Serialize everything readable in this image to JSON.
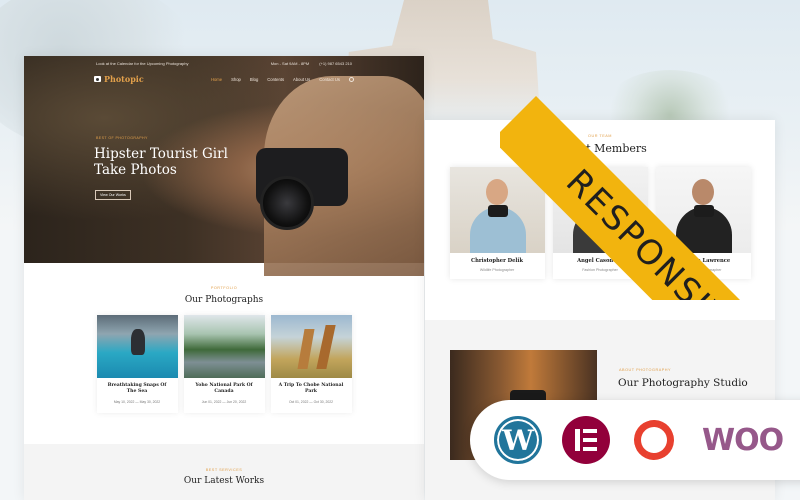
{
  "ribbon": {
    "label": "RESPONSIVE"
  },
  "topbar": {
    "left": "Look at the Calendar for the Upcoming Photography",
    "hours": "Mon - Sat 9AM - 8PM",
    "phone": "(+1) 987 6543 210"
  },
  "brand": {
    "name": "Photopic"
  },
  "nav": {
    "items": [
      "Home",
      "Shop",
      "Blog",
      "Contents",
      "About Us",
      "Contact Us"
    ],
    "active": "Home"
  },
  "hero": {
    "kicker": "BEST OF PHOTOGRAPHY",
    "title": "Hipster Tourist Girl Take Photos",
    "button": "View Our Works"
  },
  "portfolio": {
    "kicker": "PORTFOLIO",
    "title": "Our Photographs",
    "cards": [
      {
        "title": "Breathtaking Snaps Of The Sea",
        "date": "May 10, 2022 — May 30, 2022"
      },
      {
        "title": "Yoho National Park Of Canada",
        "date": "Jun 01, 2022 — Jun 20, 2022"
      },
      {
        "title": "A Trip To Chobe National Park",
        "date": "Oct 01, 2022 — Oct 30, 2022"
      }
    ]
  },
  "works": {
    "kicker": "BEST SERVICES",
    "title": "Our Latest Works"
  },
  "team": {
    "kicker": "OUR TEAM",
    "title": "Expert Members",
    "members": [
      {
        "name": "Christopher Delik",
        "role": "Wildlife Photographer"
      },
      {
        "name": "Angel Casondra",
        "role": "Fashion Photographer"
      },
      {
        "name": "Raghava Lawrence",
        "role": "Wedding Photographer"
      }
    ]
  },
  "studio": {
    "kicker": "ABOUT PHOTOGRAPHY",
    "title": "Our Photography Studio"
  },
  "badges": {
    "wordpress": "W",
    "woocommerce": "WOO"
  },
  "icons": [
    "camera-logo-icon",
    "search-icon",
    "wordpress-icon",
    "elementor-icon",
    "sync-icon",
    "woocommerce-icon"
  ],
  "colors": {
    "accent": "#e2a04b",
    "ribbon": "#f2b40e",
    "wordpress": "#21759b",
    "elementor": "#92003b",
    "sync": "#e8402f",
    "woo": "#96588a"
  }
}
